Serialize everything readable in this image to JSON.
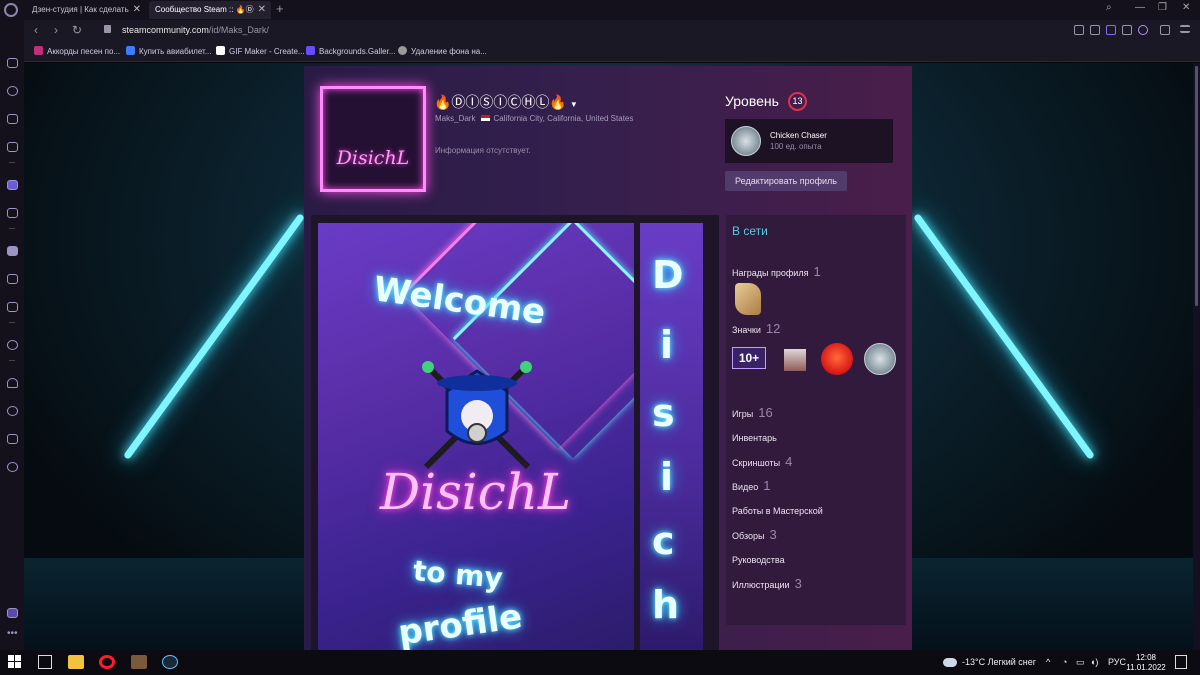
{
  "browser": {
    "tabs": [
      {
        "label": "Дзен-студия | Как сделать"
      },
      {
        "label": "Сообщество Steam :: 🔥Ⓓ"
      }
    ],
    "new_tab": "+",
    "url_host": "steamcommunity.com",
    "url_path": "/id/Maks_Dark/",
    "bookmarks": [
      {
        "label": "Аккорды песен по..."
      },
      {
        "label": "Купить авиабилет..."
      },
      {
        "label": "GIF Maker - Create..."
      },
      {
        "label": "Backgrounds.Galler..."
      },
      {
        "label": "Удаление фона на..."
      }
    ]
  },
  "profile": {
    "persona_name": "🔥ⒹⒾⓈⒾⒸⒽⓁ🔥",
    "real_name": "Maks_Dark",
    "location": "California City, California, United States",
    "summary": "Информация отсутствует.",
    "avatar_text": "DisichL",
    "level_label": "Уровень",
    "level_value": "13",
    "badge_name": "Chicken Chaser",
    "badge_xp": "100 ед. опыта",
    "edit_button": "Редактировать профиль",
    "showcase": {
      "welcome": "Welcome",
      "signature": "DisichL",
      "to_my": "to my",
      "profile": "profile",
      "side_letters": [
        "D",
        "i",
        "s",
        "i",
        "c",
        "h"
      ]
    },
    "status": "В сети",
    "links": [
      {
        "label": "Награды профиля",
        "count": "1"
      },
      {
        "label": "Значки",
        "count": "12"
      },
      {
        "label": "Игры",
        "count": "16"
      },
      {
        "label": "Инвентарь",
        "count": ""
      },
      {
        "label": "Скриншоты",
        "count": "4"
      },
      {
        "label": "Видео",
        "count": "1"
      },
      {
        "label": "Работы в Мастерской",
        "count": ""
      },
      {
        "label": "Обзоры",
        "count": "3"
      },
      {
        "label": "Руководства",
        "count": ""
      },
      {
        "label": "Иллюстрации",
        "count": "3"
      }
    ],
    "badge_tile_text": "10+"
  },
  "taskbar": {
    "weather": "-13°C  Легкий снег",
    "lang": "РУС",
    "time": "12:08",
    "date": "11.01.2022"
  }
}
